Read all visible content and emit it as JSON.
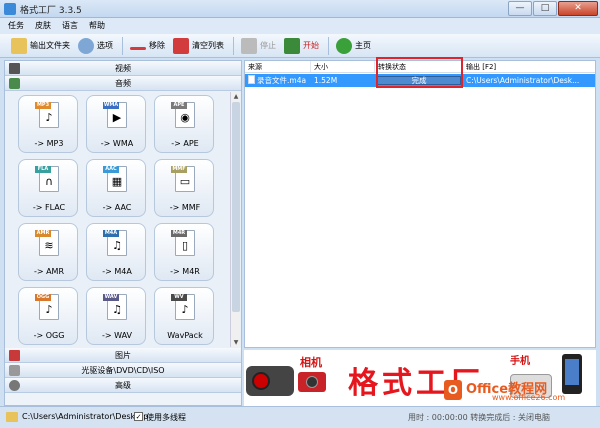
{
  "window": {
    "title": "格式工厂 3.3.5",
    "controls": {
      "minimize": "—",
      "maximize": "□",
      "close": "✕"
    }
  },
  "menu": [
    "任务",
    "皮肤",
    "语言",
    "帮助"
  ],
  "toolbar": [
    {
      "label": "输出文件夹",
      "icon": "folder-icon",
      "color": "#e8c25a",
      "enabled": true
    },
    {
      "label": "选项",
      "icon": "gear-icon",
      "color": "#7fa7d6",
      "enabled": true
    },
    {
      "label": "移除",
      "icon": "remove-icon",
      "color": "#d23c3c",
      "enabled": true
    },
    {
      "label": "清空列表",
      "icon": "clear-list-icon",
      "color": "#d23c3c",
      "enabled": true
    },
    {
      "label": "停止",
      "icon": "stop-icon",
      "color": "#bbbbbb",
      "enabled": false
    },
    {
      "label": "开始",
      "icon": "start-icon",
      "color": "#3a8a3a",
      "enabled": true
    },
    {
      "label": "主页",
      "icon": "home-globe-icon",
      "color": "#3aa03a",
      "enabled": true
    }
  ],
  "categories_top": [
    {
      "label": "视频",
      "icon": "video-film-icon"
    },
    {
      "label": "音频",
      "icon": "audio-note-icon"
    }
  ],
  "audio_formats": [
    {
      "tag": "MP3",
      "label": "-> MP3",
      "tag_color": "#e08a2c",
      "glyph": "♪"
    },
    {
      "tag": "WMA",
      "label": "-> WMA",
      "tag_color": "#3a6fc4",
      "glyph": "▶"
    },
    {
      "tag": "APE",
      "label": "-> APE",
      "tag_color": "#7a7a7a",
      "glyph": "◉"
    },
    {
      "tag": "FLA",
      "label": "-> FLAC",
      "tag_color": "#39a0a0",
      "glyph": "∩"
    },
    {
      "tag": "AAC",
      "label": "-> AAC",
      "tag_color": "#3a9ad8",
      "glyph": "▦"
    },
    {
      "tag": "MMF",
      "label": "-> MMF",
      "tag_color": "#a8a060",
      "glyph": "▭"
    },
    {
      "tag": "AMR",
      "label": "-> AMR",
      "tag_color": "#d8892c",
      "glyph": "≋"
    },
    {
      "tag": "M4A",
      "label": "-> M4A",
      "tag_color": "#2e6fb0",
      "glyph": "♫"
    },
    {
      "tag": "M4R",
      "label": "-> M4R",
      "tag_color": "#6a6a6a",
      "glyph": "▯"
    },
    {
      "tag": "OGG",
      "label": "-> OGG",
      "tag_color": "#d8782c",
      "glyph": "♪"
    },
    {
      "tag": "WAV",
      "label": "-> WAV",
      "tag_color": "#5a5a8a",
      "glyph": "♫"
    },
    {
      "tag": "WV",
      "label": "WavPack",
      "tag_color": "#4a4a4a",
      "glyph": "♪"
    }
  ],
  "categories_bottom": [
    {
      "label": "图片",
      "icon": "picture-icon"
    },
    {
      "label": "光驱设备\\DVD\\CD\\ISO",
      "icon": "disc-drive-icon"
    },
    {
      "label": "高级",
      "icon": "advanced-tools-icon"
    }
  ],
  "task_table": {
    "columns": [
      "来源",
      "大小",
      "转换状态",
      "输出 [F2]"
    ],
    "rows": [
      {
        "source": "录音文件.m4a",
        "size": "1.52M",
        "status": "完成",
        "progress": 100,
        "output": "C:\\Users\\Administrator\\Desk..."
      }
    ]
  },
  "banner": {
    "camera_label": "相机",
    "title": "格式工厂",
    "phone_label": "手机",
    "watermark_badge": "O",
    "watermark_text": "Office教程网",
    "watermark_url": "www.office26.com"
  },
  "statusbar": {
    "output_path": "C:\\Users\\Administrator\\Desktop",
    "multithread_label": "使用多线程",
    "multithread_checked": "✓",
    "right_text": "用时 : 00:00:00  转换完成后 : 关闭电脑"
  }
}
